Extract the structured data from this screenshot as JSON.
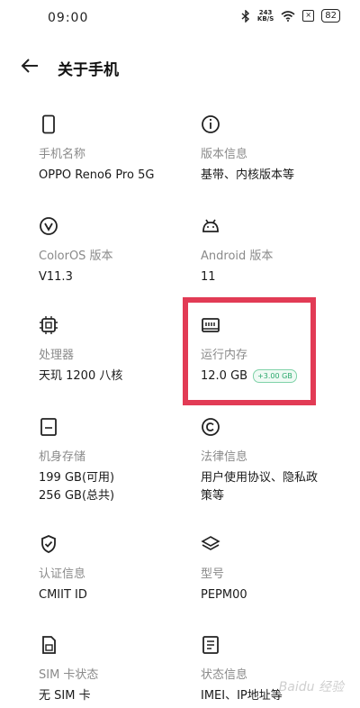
{
  "status_bar": {
    "time": "09:00",
    "net_speed": "243",
    "net_unit": "KB/S",
    "battery": "82"
  },
  "header": {
    "title": "关于手机"
  },
  "items": [
    {
      "label": "手机名称",
      "value": "OPPO Reno6 Pro 5G",
      "icon": "phone-icon"
    },
    {
      "label": "版本信息",
      "value": "基带、内核版本等",
      "icon": "info-icon"
    },
    {
      "label": "ColorOS 版本",
      "value": "V11.3",
      "icon": "coloros-icon"
    },
    {
      "label": "Android 版本",
      "value": "11",
      "icon": "android-icon"
    },
    {
      "label": "处理器",
      "value": "天玑 1200 八核",
      "icon": "processor-icon"
    },
    {
      "label": "运行内存",
      "value": "12.0 GB",
      "badge": "+3.00 GB",
      "icon": "memory-icon"
    },
    {
      "label": "机身存储",
      "value": "199 GB(可用)",
      "value2": "256 GB(总共)",
      "icon": "storage-icon"
    },
    {
      "label": "法律信息",
      "value": "用户使用协议、隐私政",
      "value2": "策等",
      "icon": "copyright-icon"
    },
    {
      "label": "认证信息",
      "value": "CMIIT ID",
      "icon": "shield-icon"
    },
    {
      "label": "型号",
      "value": "PEPM00",
      "icon": "layers-icon"
    },
    {
      "label": "SIM 卡状态",
      "value": "无 SIM 卡",
      "icon": "sim-icon"
    },
    {
      "label": "状态信息",
      "value": "IMEI、IP地址等",
      "icon": "document-icon"
    }
  ],
  "watermark": "Baidu 经验",
  "colors": {
    "highlight": "#e23b55",
    "badge": "#2aa86c"
  }
}
